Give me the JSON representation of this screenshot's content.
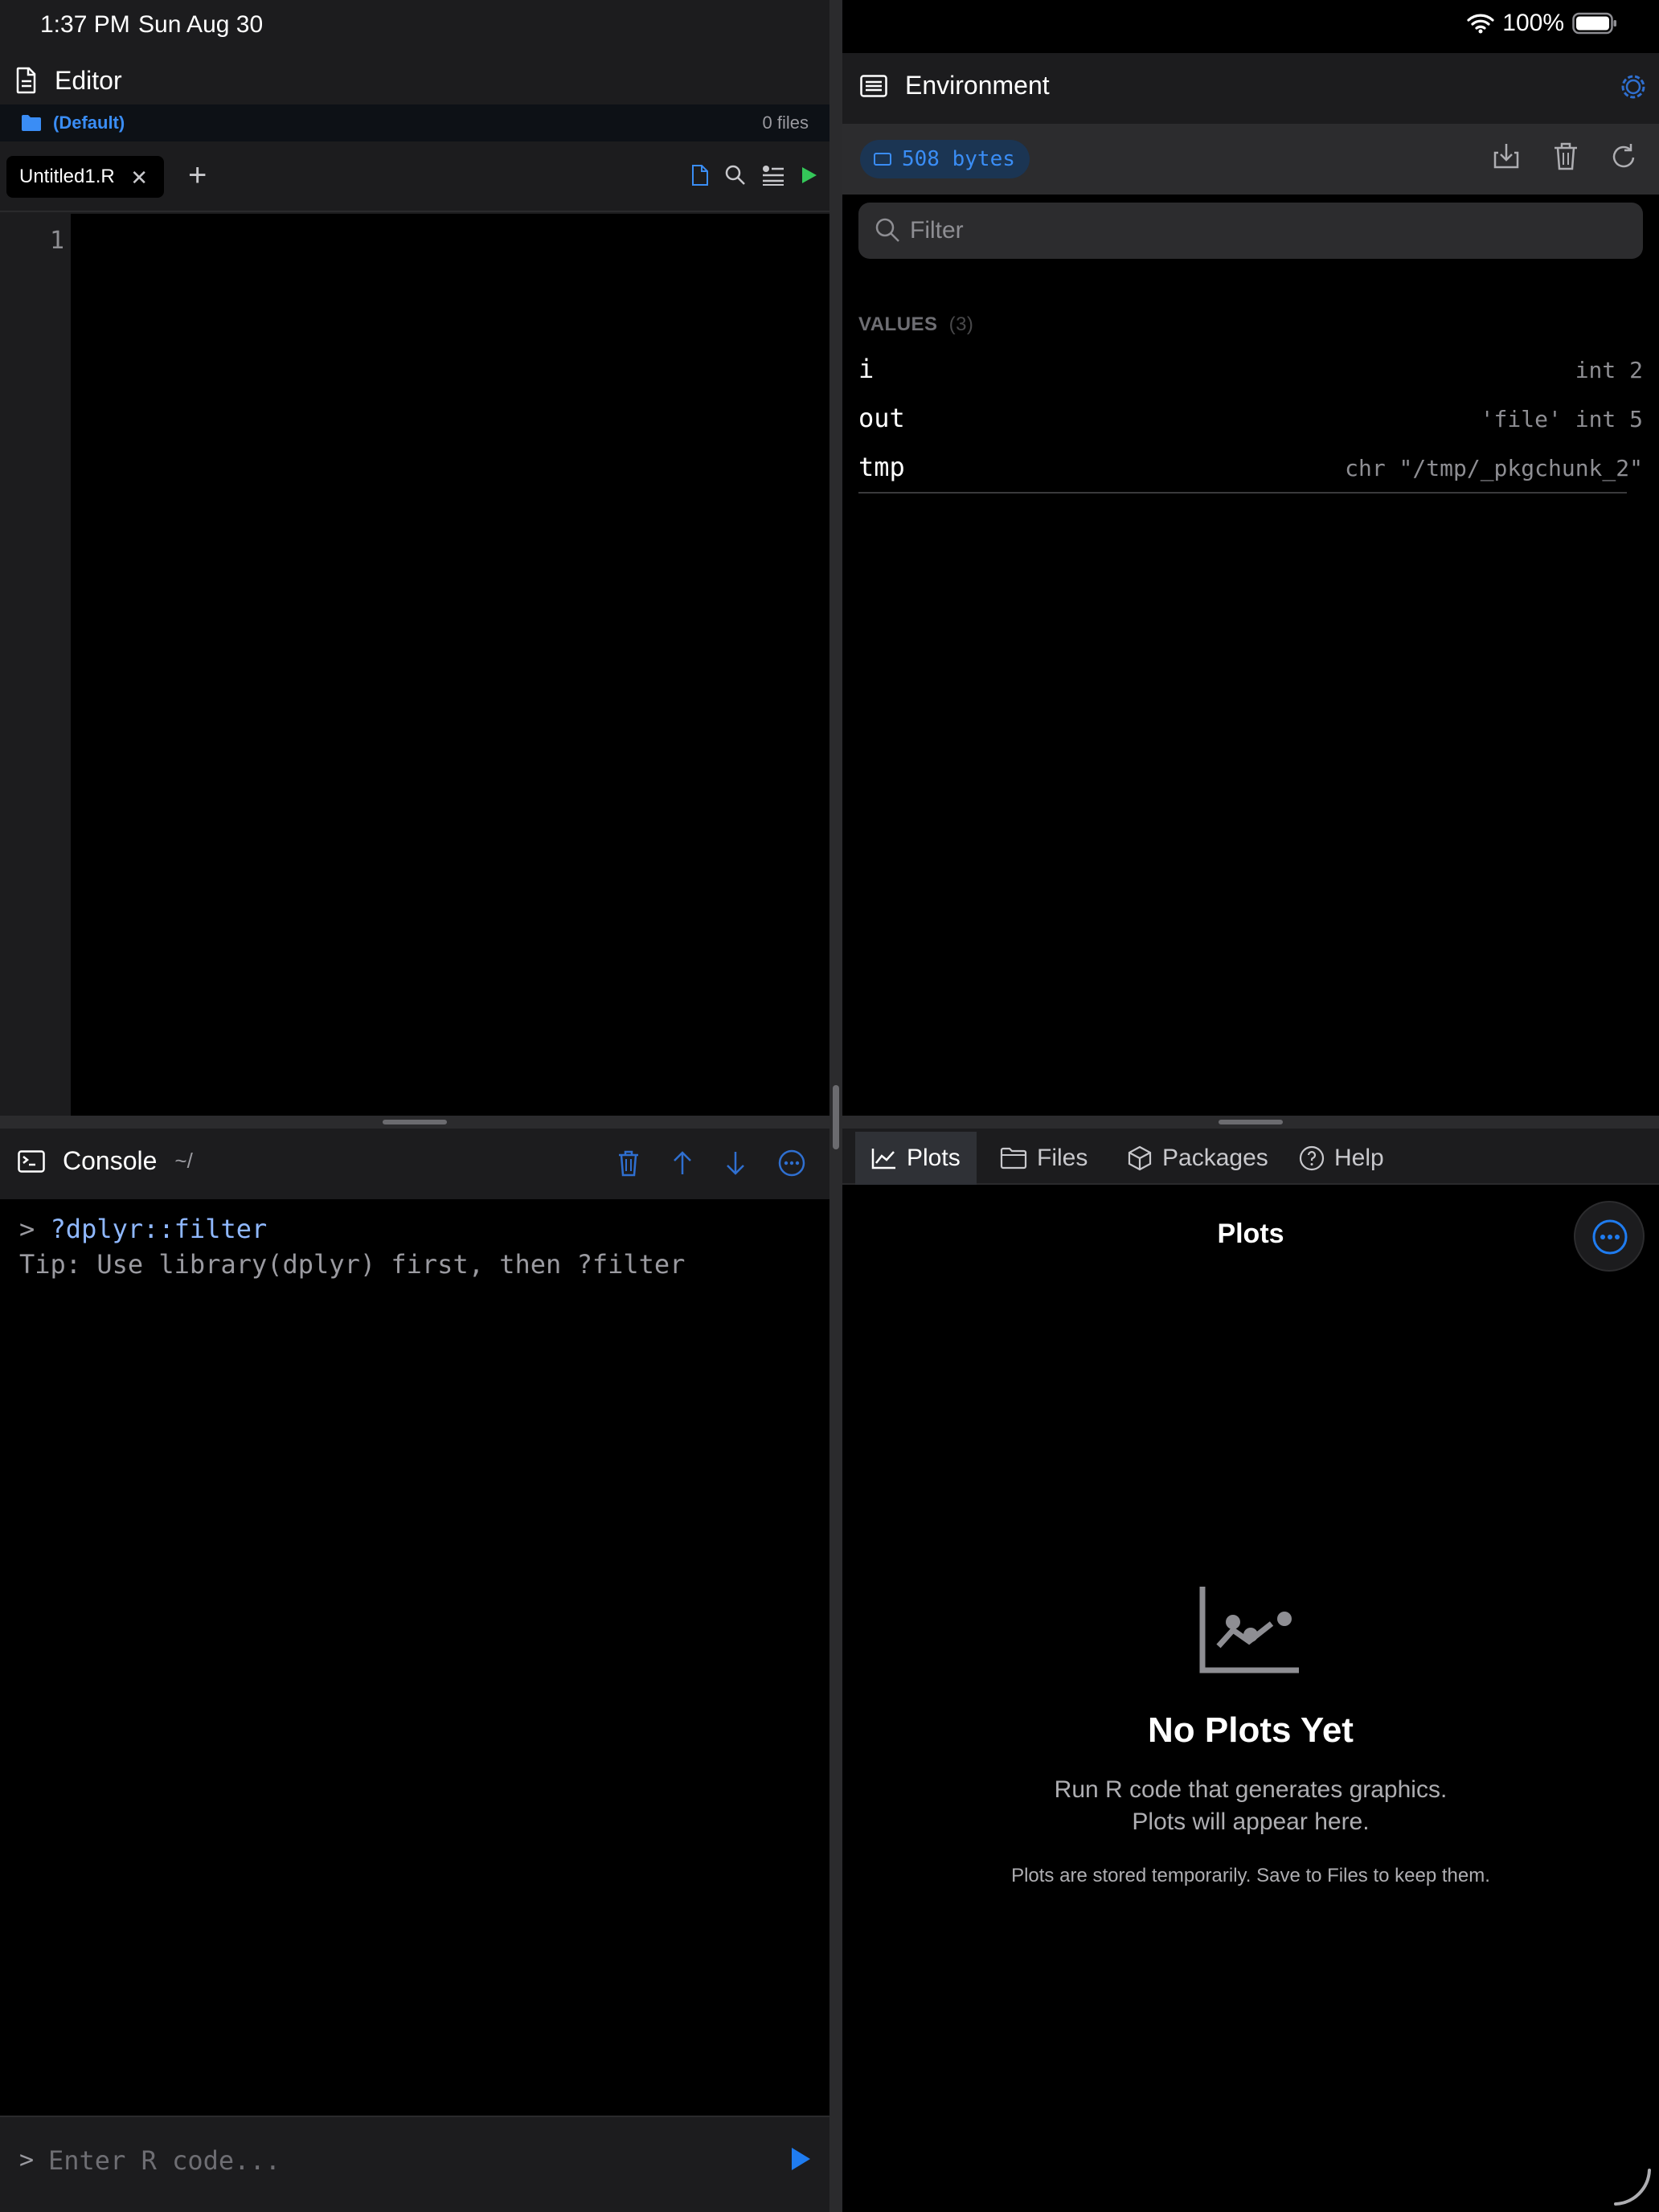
{
  "status_bar": {
    "time": "1:37 PM",
    "date": "Sun Aug 30",
    "battery": "100%"
  },
  "editor": {
    "title": "Editor",
    "project": "(Default)",
    "file_count": "0 files",
    "tabs": [
      {
        "label": "Untitled1.R"
      }
    ],
    "line_numbers": [
      "1"
    ]
  },
  "console": {
    "title": "Console",
    "path": "~/",
    "prompt": ">",
    "history": [
      {
        "prompt": ">",
        "command": "?dplyr::filter"
      },
      {
        "output": "Tip: Use library(dplyr) first, then ?filter"
      }
    ],
    "input_placeholder": "Enter R code..."
  },
  "environment": {
    "title": "Environment",
    "memory": "508 bytes",
    "filter_placeholder": "Filter",
    "section_label": "VALUES",
    "section_count": "(3)",
    "variables": [
      {
        "name": "i",
        "value": "int 2"
      },
      {
        "name": "out",
        "value": "'file' int 5"
      },
      {
        "name": "tmp",
        "value": "chr \"/tmp/_pkgchunk_2\""
      }
    ]
  },
  "pane_tabs": [
    {
      "label": "Plots",
      "active": true
    },
    {
      "label": "Files"
    },
    {
      "label": "Packages"
    },
    {
      "label": "Help"
    }
  ],
  "plots": {
    "title": "Plots",
    "empty_title": "No Plots Yet",
    "empty_line1": "Run R code that generates graphics.",
    "empty_line2": "Plots will appear here.",
    "empty_note": "Plots are stored temporarily. Save to Files to keep them."
  },
  "colors": {
    "accent": "#3a8df5",
    "run_green": "#34c759",
    "panel": "#1c1c1e",
    "background": "#000000"
  }
}
